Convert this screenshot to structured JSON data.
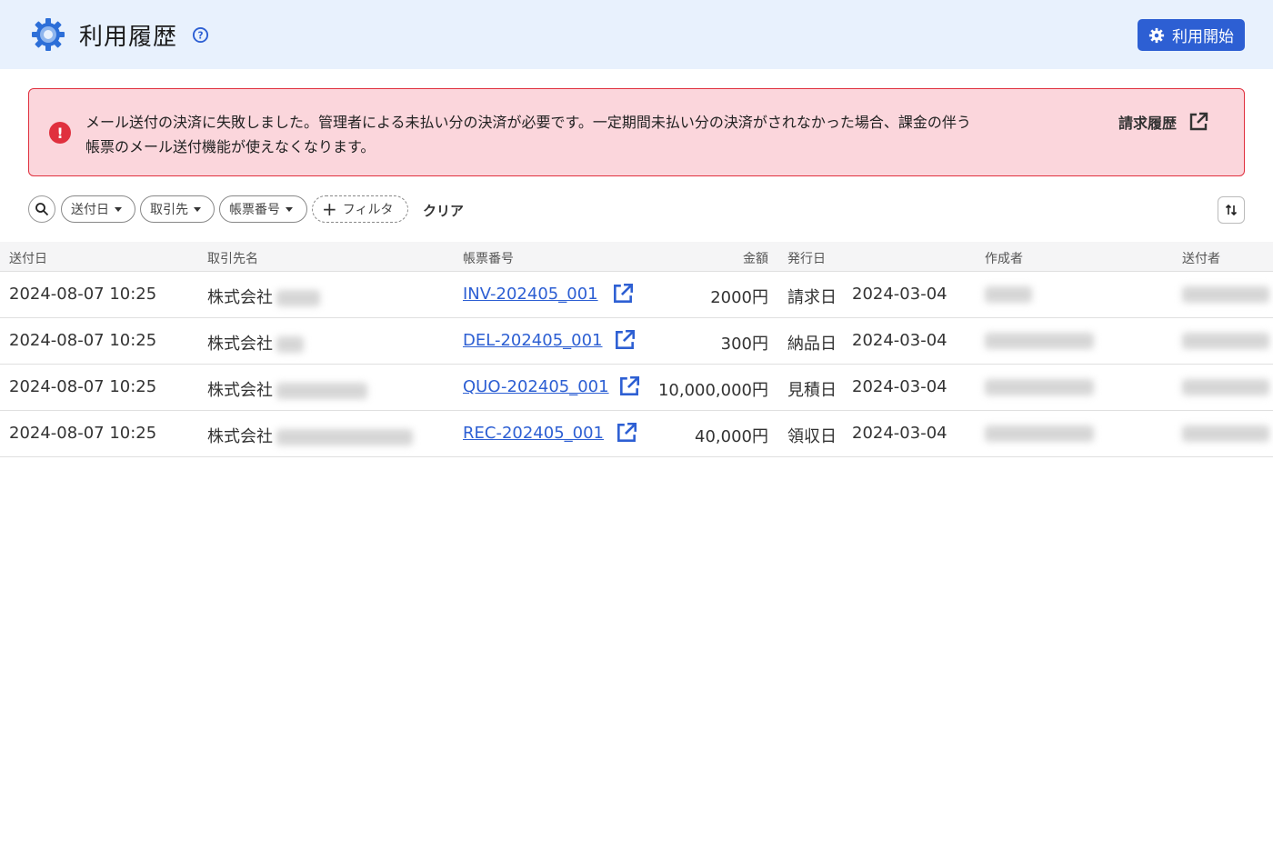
{
  "header": {
    "title": "利用履歴",
    "start_button": "利用開始"
  },
  "alert": {
    "message_line1": "メール送付の決済に失敗しました。管理者による未払い分の決済が必要です。一定期間未払い分の決済がされなかった場合、課金の伴う",
    "message_line2": "帳票のメール送付機能が使えなくなります。",
    "link_label": "請求履歴"
  },
  "filters": {
    "chips": [
      "送付日",
      "取引先",
      "帳票番号"
    ],
    "add_filter": "フィルタ",
    "clear": "クリア"
  },
  "table": {
    "columns": [
      "送付日",
      "取引先名",
      "帳票番号",
      "金額",
      "発行日",
      "作成者",
      "送付者"
    ],
    "rows": [
      {
        "sent": "2024-08-07 10:25",
        "client": "株式会社",
        "doc": "INV-202405_001",
        "amount": "2000円",
        "date_type": "請求日",
        "date": "2024-03-04"
      },
      {
        "sent": "2024-08-07 10:25",
        "client": "株式会社",
        "doc": "DEL-202405_001",
        "amount": "300円",
        "date_type": "納品日",
        "date": "2024-03-04"
      },
      {
        "sent": "2024-08-07 10:25",
        "client": "株式会社",
        "doc": "QUO-202405_001",
        "amount": "10,000,000円",
        "date_type": "見積日",
        "date": "2024-03-04"
      },
      {
        "sent": "2024-08-07 10:25",
        "client": "株式会社",
        "doc": "REC-202405_001",
        "amount": "40,000円",
        "date_type": "領収日",
        "date": "2024-03-04"
      }
    ]
  },
  "colors": {
    "accent": "#2d5fd3",
    "header_bg": "#e8f1fd",
    "alert_bg": "#fbd6dc",
    "alert_border": "#e0303e"
  },
  "icons": [
    "gear-icon",
    "help-icon",
    "error-icon",
    "external-link-icon",
    "search-icon",
    "caret-down-icon",
    "plus-icon",
    "sort-icon"
  ]
}
